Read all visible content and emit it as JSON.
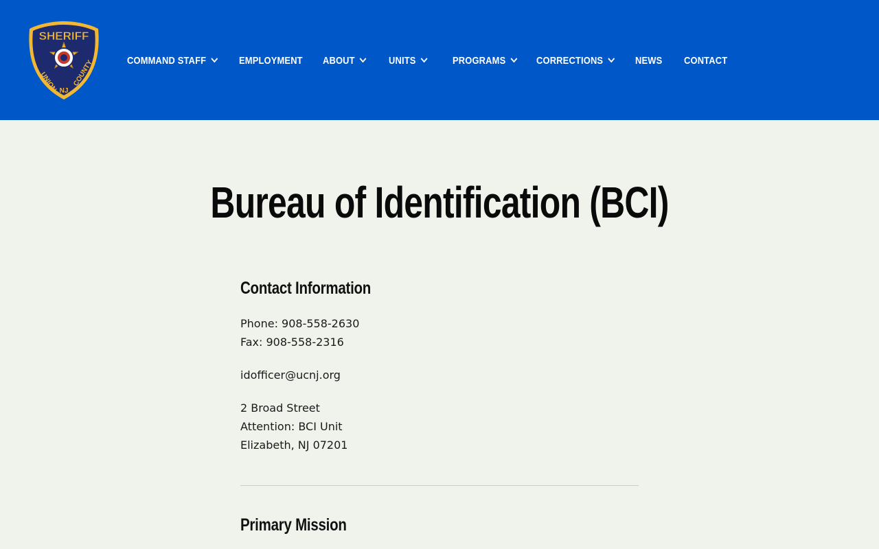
{
  "header": {
    "logo": {
      "top_text": "SHERIFF",
      "left_text": "UNION",
      "right_text": "COUNTY",
      "bottom_text": "NJ",
      "colors": {
        "navy": "#1d2a6e",
        "gold": "#f2b733"
      }
    },
    "nav": [
      {
        "label": "COMMAND STAFF",
        "has_dropdown": true
      },
      {
        "label": "EMPLOYMENT",
        "has_dropdown": false
      },
      {
        "label": "ABOUT",
        "has_dropdown": true
      },
      {
        "label": "UNITS",
        "has_dropdown": true
      },
      {
        "label": "PROGRAMS",
        "has_dropdown": true
      },
      {
        "label": "CORRECTIONS",
        "has_dropdown": true
      },
      {
        "label": "NEWS",
        "has_dropdown": false
      },
      {
        "label": "CONTACT",
        "has_dropdown": false
      }
    ],
    "background_color": "#0057c8"
  },
  "page": {
    "title": "Bureau of Identification (BCI)",
    "background_color": "#f0f3ec"
  },
  "contact": {
    "heading": "Contact Information",
    "phone": "Phone: 908-558-2630",
    "fax": "Fax: 908-558-2316",
    "email": "idofficer@ucnj.org",
    "address": {
      "line1": "2 Broad Street",
      "line2": "Attention: BCI Unit",
      "line3": "Elizabeth, NJ 07201"
    }
  },
  "mission": {
    "heading": "Primary Mission"
  }
}
